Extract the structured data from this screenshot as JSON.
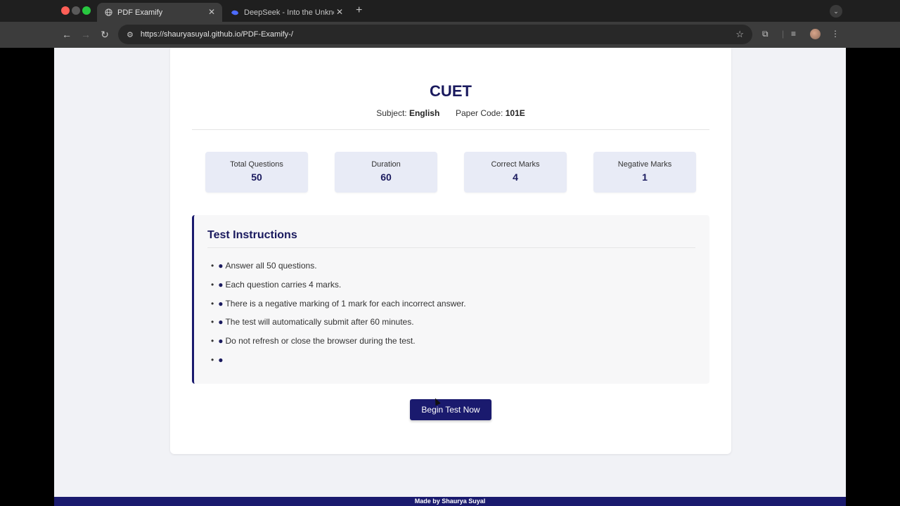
{
  "browser": {
    "tabs": [
      {
        "title": "PDF Examify",
        "active": true
      },
      {
        "title": "DeepSeek - Into the Unknown",
        "active": false
      }
    ],
    "url": "https://shauryasuyal.github.io/PDF-Examify-/",
    "colors": {
      "close": "#ff5f57",
      "minimize": "#5a5a5a",
      "maximize": "#28c840"
    }
  },
  "exam": {
    "title": "CUET",
    "subject_label": "Subject:",
    "subject": "English",
    "paper_code_label": "Paper Code:",
    "paper_code": "101E"
  },
  "stats": [
    {
      "label": "Total Questions",
      "value": "50"
    },
    {
      "label": "Duration",
      "value": "60"
    },
    {
      "label": "Correct Marks",
      "value": "4"
    },
    {
      "label": "Negative Marks",
      "value": "1"
    }
  ],
  "instructions": {
    "heading": "Test Instructions",
    "items": [
      "Answer all 50 questions.",
      "Each question carries 4 marks.",
      "There is a negative marking of 1 mark for each incorrect answer.",
      "The test will automatically submit after 60 minutes.",
      "Do not refresh or close the browser during the test.",
      ""
    ]
  },
  "begin_label": "Begin Test Now",
  "footer": "Made by Shaurya Suyal",
  "theme": {
    "primary": "#1a1a6e",
    "stat_bg": "#e8ebf6"
  }
}
